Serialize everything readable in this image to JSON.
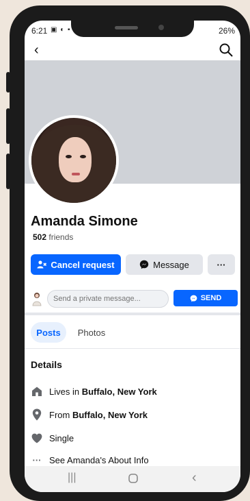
{
  "status": {
    "time": "6:21",
    "left_icons": "▣ ◐ ▪",
    "right_text": "26%"
  },
  "profile": {
    "name": "Amanda Simone",
    "friend_count": "502",
    "friends_label": "friends"
  },
  "actions": {
    "cancel_label": "Cancel request",
    "message_label": "Message",
    "more_label": "···"
  },
  "dm": {
    "placeholder": "Send a private message...",
    "send_label": "SEND"
  },
  "tabs": [
    {
      "label": "Posts"
    },
    {
      "label": "Photos"
    }
  ],
  "details": {
    "heading": "Details",
    "lives_prefix": "Lives in ",
    "lives_place": "Buffalo, New York",
    "from_prefix": "From ",
    "from_place": "Buffalo, New York",
    "relationship": "Single",
    "about": "See Amanda's About Info"
  },
  "colors": {
    "accent": "#0866ff",
    "cover": "#cfd2d7"
  }
}
